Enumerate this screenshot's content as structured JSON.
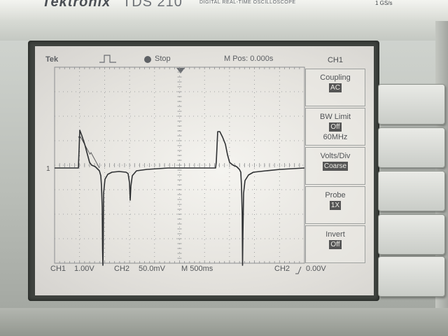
{
  "header": {
    "brand": "Tektronix",
    "model": "TDS 210",
    "tagline": "DIGITAL REAL-TIME OSCILLOSCOPE",
    "sample_rate": "1 GS/s"
  },
  "status": {
    "logo": "Tek",
    "run_state": "Stop",
    "m_pos": "M Pos: 0.000s"
  },
  "menu": {
    "title": "CH1",
    "items": [
      {
        "name": "Coupling",
        "value": "AC",
        "sub": ""
      },
      {
        "name": "BW Limit",
        "value": "Off",
        "sub": "60MHz"
      },
      {
        "name": "Volts/Div",
        "value": "Coarse",
        "sub": ""
      },
      {
        "name": "Probe",
        "value": "1X",
        "sub": ""
      },
      {
        "name": "Invert",
        "value": "Off",
        "sub": ""
      }
    ]
  },
  "bottom": {
    "ch1": "CH1",
    "ch1_scale": "1.00V",
    "ch2": "CH2",
    "ch2_scale": "50.0mV",
    "timebase": "M 500ms",
    "trigger": "CH2",
    "trigger_level": "0.00V"
  },
  "ground_marker": "1",
  "colors": {
    "trace": "#2f3133",
    "grid": "#8c8e90",
    "screen_bg": "#ebe9e4"
  }
}
